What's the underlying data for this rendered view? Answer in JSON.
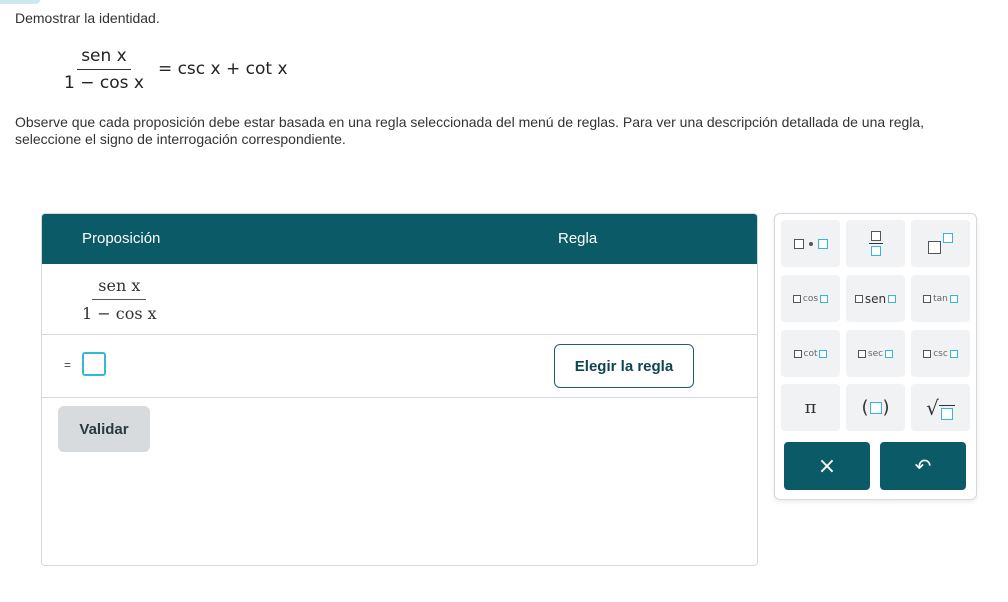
{
  "prompt": "Demostrar la identidad.",
  "identity": {
    "lhs_numerator": "sen x",
    "lhs_denominator": "1 − cos x",
    "rhs": "= csc x + cot x"
  },
  "instructions": "Observe que cada proposición debe estar basada en una regla seleccionada del menú de reglas. Para ver una descripción detallada de una regla, seleccione el signo de interrogación correspondiente.",
  "table": {
    "header_proposition": "Proposición",
    "header_rule": "Regla",
    "first_statement_numerator": "sen x",
    "first_statement_denominator": "1 − cos x",
    "second_statement_prefix": "=",
    "choose_rule_label": "Elegir la regla"
  },
  "validate_label": "Validar",
  "keypad": {
    "trig_labels": [
      "cos",
      "sen",
      "tan",
      "cot",
      "sec",
      "csc"
    ],
    "pi": "π",
    "clear": "×",
    "undo": "↶"
  },
  "colors": {
    "header": "#0b5a68",
    "accent": "#35b8d8",
    "validate": "#d7dbde"
  }
}
